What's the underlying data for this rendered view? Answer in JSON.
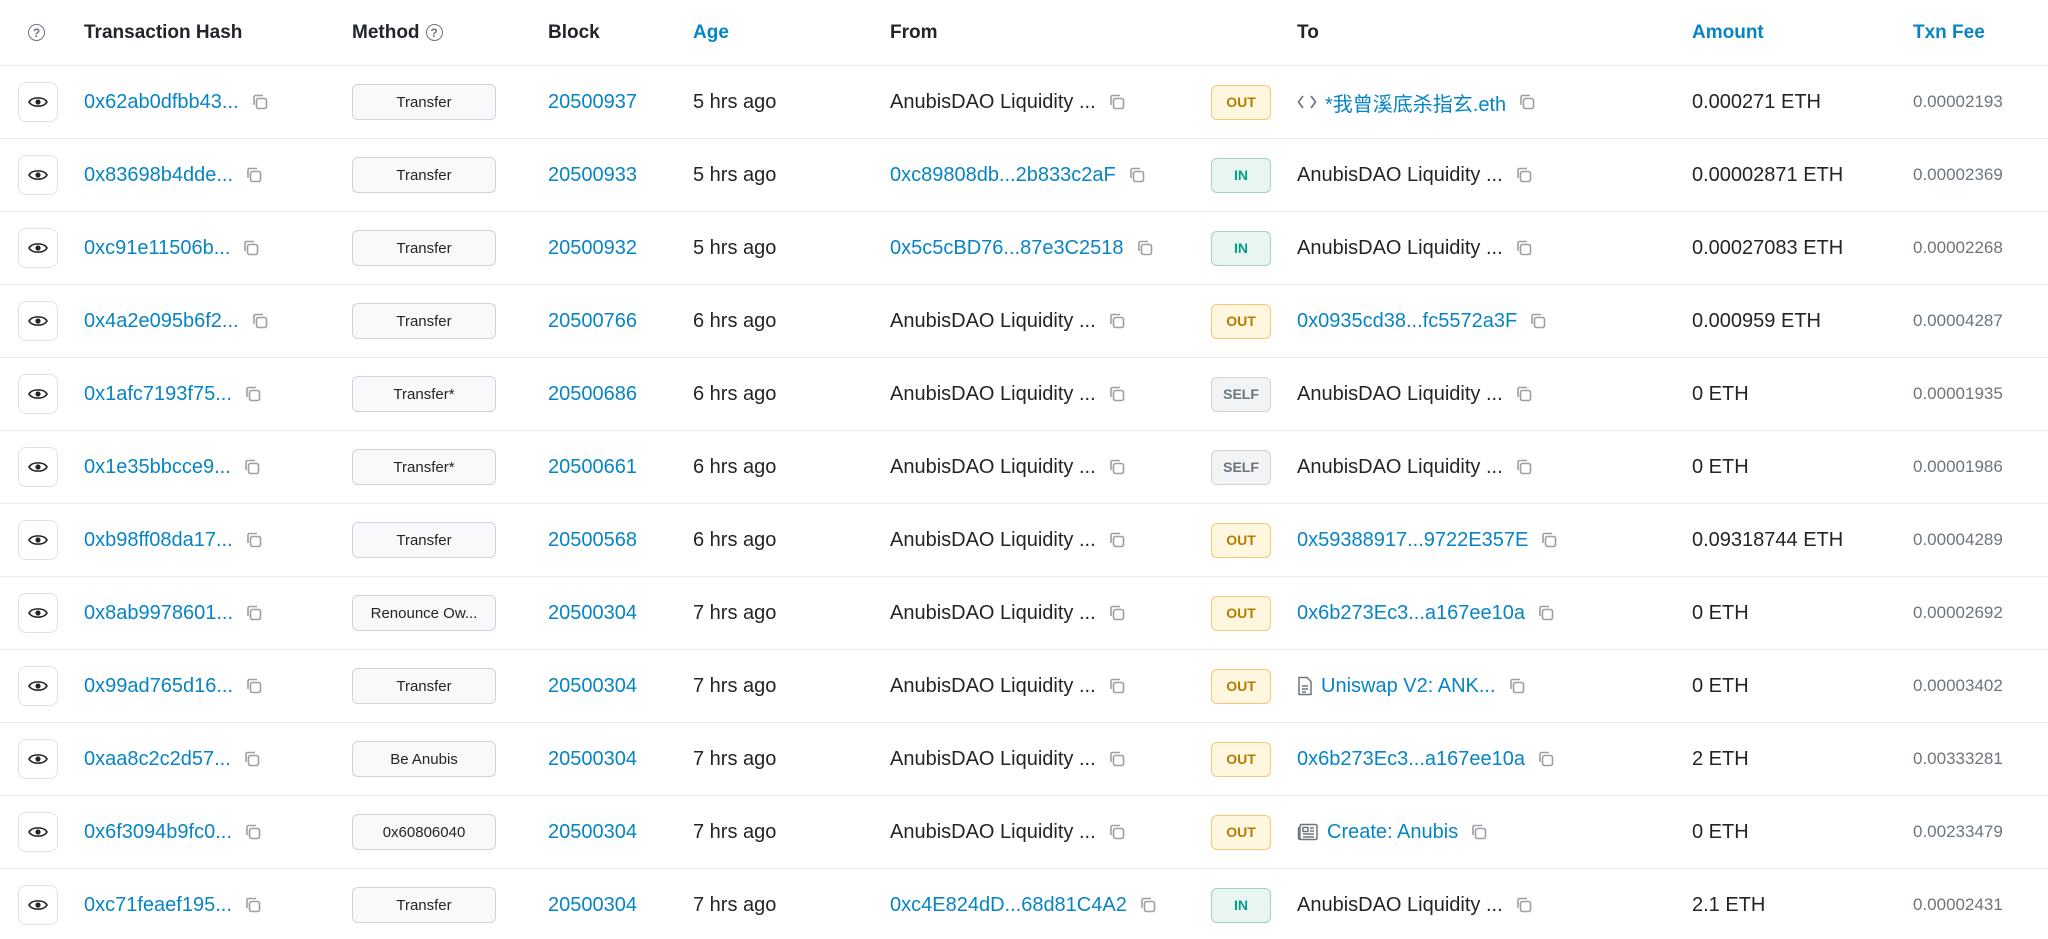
{
  "header": {
    "tx_hash": "Transaction Hash",
    "method": "Method",
    "block": "Block",
    "age": "Age",
    "from": "From",
    "to": "To",
    "amount": "Amount",
    "fee": "Txn Fee",
    "q_glyph": "?"
  },
  "rows": [
    {
      "hash": "0x62ab0dfbb43...",
      "method": "Transfer",
      "block": "20500937",
      "age": "5 hrs ago",
      "from": "AnubisDAO Liquidity ...",
      "from_link": false,
      "dir": "OUT",
      "to": "*我曾溪底杀指玄.eth",
      "to_link": true,
      "to_icon": "code",
      "amount": "0.000271 ETH",
      "fee": "0.00002193"
    },
    {
      "hash": "0x83698b4dde...",
      "method": "Transfer",
      "block": "20500933",
      "age": "5 hrs ago",
      "from": "0xc89808db...2b833c2aF",
      "from_link": true,
      "dir": "IN",
      "to": "AnubisDAO Liquidity ...",
      "to_link": false,
      "to_icon": "",
      "amount": "0.00002871 ETH",
      "fee": "0.00002369"
    },
    {
      "hash": "0xc91e11506b...",
      "method": "Transfer",
      "block": "20500932",
      "age": "5 hrs ago",
      "from": "0x5c5cBD76...87e3C2518",
      "from_link": true,
      "dir": "IN",
      "to": "AnubisDAO Liquidity ...",
      "to_link": false,
      "to_icon": "",
      "amount": "0.00027083 ETH",
      "fee": "0.00002268"
    },
    {
      "hash": "0x4a2e095b6f2...",
      "method": "Transfer",
      "block": "20500766",
      "age": "6 hrs ago",
      "from": "AnubisDAO Liquidity ...",
      "from_link": false,
      "dir": "OUT",
      "to": "0x0935cd38...fc5572a3F",
      "to_link": true,
      "to_icon": "",
      "amount": "0.000959 ETH",
      "fee": "0.00004287"
    },
    {
      "hash": "0x1afc7193f75...",
      "method": "Transfer*",
      "block": "20500686",
      "age": "6 hrs ago",
      "from": "AnubisDAO Liquidity ...",
      "from_link": false,
      "dir": "SELF",
      "to": "AnubisDAO Liquidity ...",
      "to_link": false,
      "to_icon": "",
      "amount": "0 ETH",
      "fee": "0.00001935"
    },
    {
      "hash": "0x1e35bbcce9...",
      "method": "Transfer*",
      "block": "20500661",
      "age": "6 hrs ago",
      "from": "AnubisDAO Liquidity ...",
      "from_link": false,
      "dir": "SELF",
      "to": "AnubisDAO Liquidity ...",
      "to_link": false,
      "to_icon": "",
      "amount": "0 ETH",
      "fee": "0.00001986"
    },
    {
      "hash": "0xb98ff08da17...",
      "method": "Transfer",
      "block": "20500568",
      "age": "6 hrs ago",
      "from": "AnubisDAO Liquidity ...",
      "from_link": false,
      "dir": "OUT",
      "to": "0x59388917...9722E357E",
      "to_link": true,
      "to_icon": "",
      "amount": "0.09318744 ETH",
      "fee": "0.00004289"
    },
    {
      "hash": "0x8ab9978601...",
      "method": "Renounce Ow...",
      "block": "20500304",
      "age": "7 hrs ago",
      "from": "AnubisDAO Liquidity ...",
      "from_link": false,
      "dir": "OUT",
      "to": "0x6b273Ec3...a167ee10a",
      "to_link": true,
      "to_icon": "",
      "amount": "0 ETH",
      "fee": "0.00002692"
    },
    {
      "hash": "0x99ad765d16...",
      "method": "Transfer",
      "block": "20500304",
      "age": "7 hrs ago",
      "from": "AnubisDAO Liquidity ...",
      "from_link": false,
      "dir": "OUT",
      "to": "Uniswap V2: ANK...",
      "to_link": true,
      "to_icon": "file",
      "amount": "0 ETH",
      "fee": "0.00003402"
    },
    {
      "hash": "0xaa8c2c2d57...",
      "method": "Be Anubis",
      "block": "20500304",
      "age": "7 hrs ago",
      "from": "AnubisDAO Liquidity ...",
      "from_link": false,
      "dir": "OUT",
      "to": "0x6b273Ec3...a167ee10a",
      "to_link": true,
      "to_icon": "",
      "amount": "2 ETH",
      "fee": "0.00333281"
    },
    {
      "hash": "0x6f3094b9fc0...",
      "method": "0x60806040",
      "block": "20500304",
      "age": "7 hrs ago",
      "from": "AnubisDAO Liquidity ...",
      "from_link": false,
      "dir": "OUT",
      "to": "Create: Anubis",
      "to_link": true,
      "to_icon": "newspaper",
      "amount": "0 ETH",
      "fee": "0.00233479"
    },
    {
      "hash": "0xc71feaef195...",
      "method": "Transfer",
      "block": "20500304",
      "age": "7 hrs ago",
      "from": "0xc4E824dD...68d81C4A2",
      "from_link": true,
      "dir": "IN",
      "to": "AnubisDAO Liquidity ...",
      "to_link": false,
      "to_icon": "",
      "amount": "2.1 ETH",
      "fee": "0.00002431"
    }
  ],
  "colors": {
    "link": "#0784c3",
    "out_bg": "#fff6e0",
    "in_bg": "#e9f5f1",
    "self_bg": "#f1f3f5"
  }
}
